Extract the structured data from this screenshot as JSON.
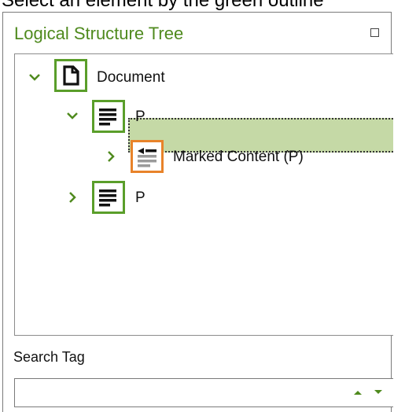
{
  "clipped_heading": "Select an element by the green outline",
  "panel": {
    "title": "Logical Structure Tree",
    "maximize_icon": "square-icon"
  },
  "tree": {
    "nodes": [
      {
        "label": "Document",
        "icon": "document-icon",
        "expanded": true
      },
      {
        "label": "P",
        "icon": "paragraph-icon",
        "expanded": true,
        "selected": true
      },
      {
        "label": "Marked Content (P)",
        "icon": "marked-content-icon",
        "expanded": false
      },
      {
        "label": "P",
        "icon": "paragraph-icon",
        "expanded": false
      }
    ]
  },
  "search": {
    "label": "Search Tag",
    "value": "",
    "up_icon": "arrow-up-icon",
    "down_icon": "arrow-down-icon"
  },
  "colors": {
    "accent_green": "#5a9e2a",
    "title_green": "#4f8a1e",
    "selection": "#c5d9a6",
    "highlight_orange": "#e8832a"
  }
}
